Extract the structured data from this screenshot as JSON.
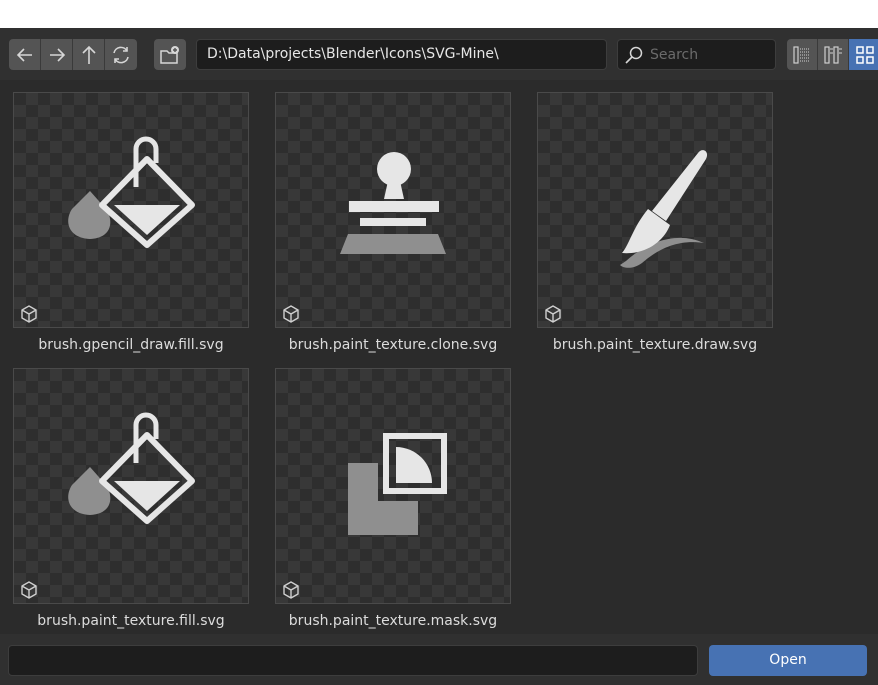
{
  "toolbar": {
    "path": "D:\\Data\\projects\\Blender\\Icons\\SVG-Mine\\",
    "search_placeholder": "Search"
  },
  "files": [
    {
      "name": "brush.gpencil_draw.fill.svg",
      "icon": "paint-bucket-icon"
    },
    {
      "name": "brush.paint_texture.clone.svg",
      "icon": "stamp-icon"
    },
    {
      "name": "brush.paint_texture.draw.svg",
      "icon": "paintbrush-icon"
    },
    {
      "name": "brush.paint_texture.fill.svg",
      "icon": "paint-bucket-icon"
    },
    {
      "name": "brush.paint_texture.mask.svg",
      "icon": "mask-icon"
    }
  ],
  "footer": {
    "filename_value": "",
    "open_label": "Open"
  },
  "colors": {
    "accent": "#4772b3",
    "background": "#2b2b2b",
    "toolbar": "#303030"
  }
}
